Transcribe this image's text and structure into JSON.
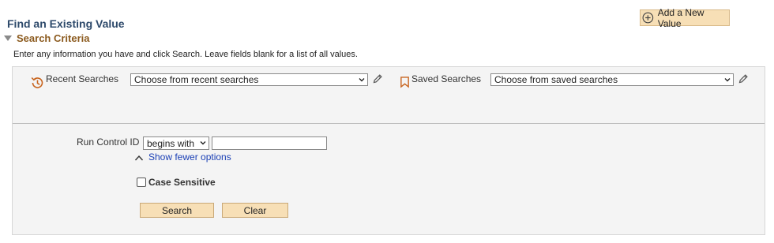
{
  "header": {
    "title": "Find an Existing Value",
    "add_new_label": "Add a New Value"
  },
  "search_criteria": {
    "section_label": "Search Criteria",
    "instructions": "Enter any information you have and click Search. Leave fields blank for a list of all values."
  },
  "recent": {
    "label": "Recent Searches",
    "selected": "Choose from recent searches"
  },
  "saved": {
    "label": "Saved Searches",
    "selected": "Choose from saved searches"
  },
  "run_control": {
    "label": "Run Control ID",
    "operator": "begins with",
    "value": ""
  },
  "options": {
    "show_fewer_label": "Show fewer options",
    "case_sensitive_label": "Case Sensitive",
    "case_sensitive_checked": false
  },
  "buttons": {
    "search_label": "Search",
    "clear_label": "Clear"
  },
  "colors": {
    "accent_button": "#f7dfb6",
    "title": "#2e4a6b",
    "section": "#8b5a1e",
    "link": "#1a3fb5",
    "icon_orange": "#c8641e"
  }
}
